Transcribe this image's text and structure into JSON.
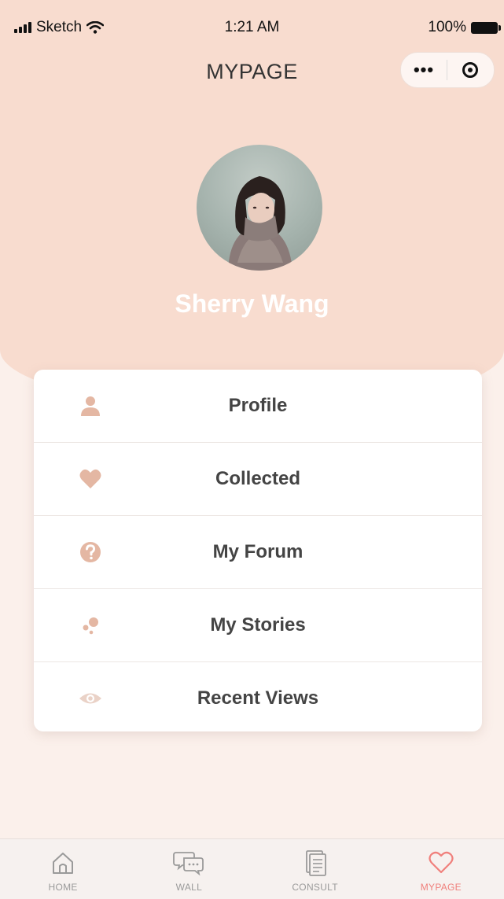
{
  "status_bar": {
    "carrier": "Sketch",
    "time": "1:21 AM",
    "battery": "100%"
  },
  "nav": {
    "title": "MYPAGE",
    "more_label": "•••"
  },
  "user": {
    "name": "Sherry Wang"
  },
  "menu": [
    {
      "label": "Profile",
      "icon": "person-icon"
    },
    {
      "label": "Collected",
      "icon": "heart-icon"
    },
    {
      "label": "My Forum",
      "icon": "question-icon"
    },
    {
      "label": "My Stories",
      "icon": "bubbles-icon"
    },
    {
      "label": "Recent Views",
      "icon": "eye-icon"
    }
  ],
  "tabs": [
    {
      "label": "HOME",
      "icon": "home-icon",
      "active": false
    },
    {
      "label": "WALL",
      "icon": "chat-icon",
      "active": false
    },
    {
      "label": "CONSULT",
      "icon": "document-icon",
      "active": false
    },
    {
      "label": "MYPAGE",
      "icon": "heart-outline-icon",
      "active": true
    }
  ],
  "colors": {
    "header_bg": "#f8dccf",
    "page_bg": "#fbf0eb",
    "icon_accent": "#e4b7a3",
    "active_tab": "#f0807c"
  }
}
